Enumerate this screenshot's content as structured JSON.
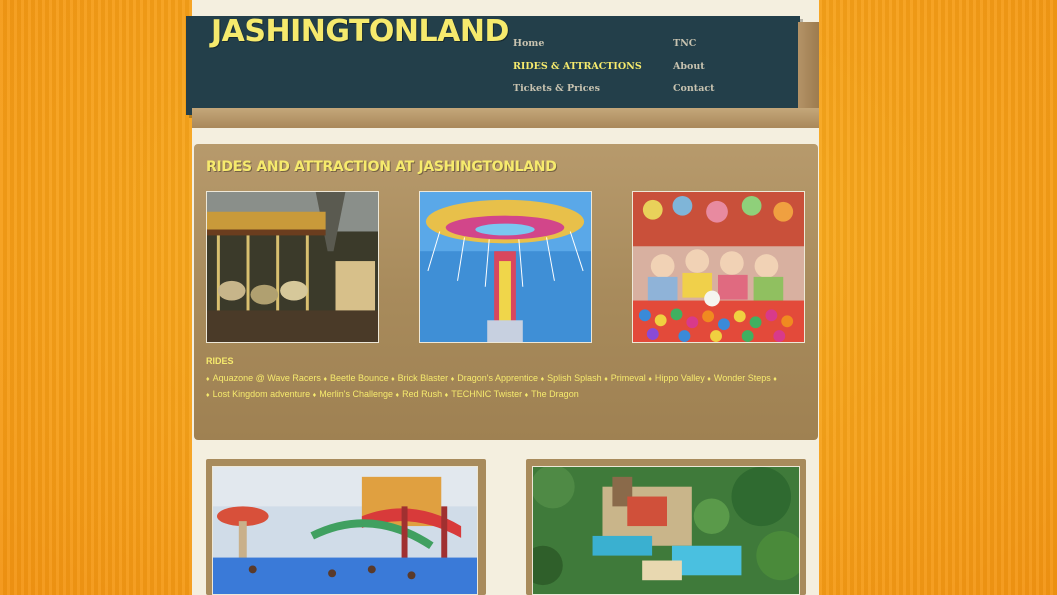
{
  "site": {
    "logo": "JASHINGTONLAND"
  },
  "nav": {
    "items": [
      {
        "label": "Home"
      },
      {
        "label": "RIDES & ATTRACTIONS",
        "active": true
      },
      {
        "label": "Tickets & Prices"
      },
      {
        "label": "TNC"
      },
      {
        "label": "About"
      },
      {
        "label": "Contact"
      }
    ]
  },
  "feature": {
    "title": "RIDES AND ATTRACTION AT JASHINGTONLAND",
    "photos": [
      {
        "subject": "carousel-photo"
      },
      {
        "subject": "swing-ride-photo"
      },
      {
        "subject": "game-booth-photo"
      }
    ]
  },
  "rides": {
    "heading": "RIDES",
    "line1": [
      "Aquazone @ Wave Racers",
      "Beetle Bounce",
      "Brick Blaster",
      "Dragon's Apprentice",
      "Splish Splash",
      "Primeval",
      "Hippo Valley",
      "Wonder Steps"
    ],
    "line2": [
      "Lost Kingdom adventure",
      "Merlin's Challenge",
      "Red Rush",
      "TECHNIC Twister",
      "The Dragon"
    ]
  },
  "cards": [
    {
      "subject": "water-park-photo"
    },
    {
      "subject": "aerial-park-photo"
    }
  ],
  "colors": {
    "header_bg": "#233f4a",
    "accent_yellow": "#f6ea6d",
    "nav_text": "#c8c3b0",
    "panel_tan": "#a88b5c",
    "page_bg": "#f4efdf",
    "outer_orange": "#f7a51b"
  }
}
